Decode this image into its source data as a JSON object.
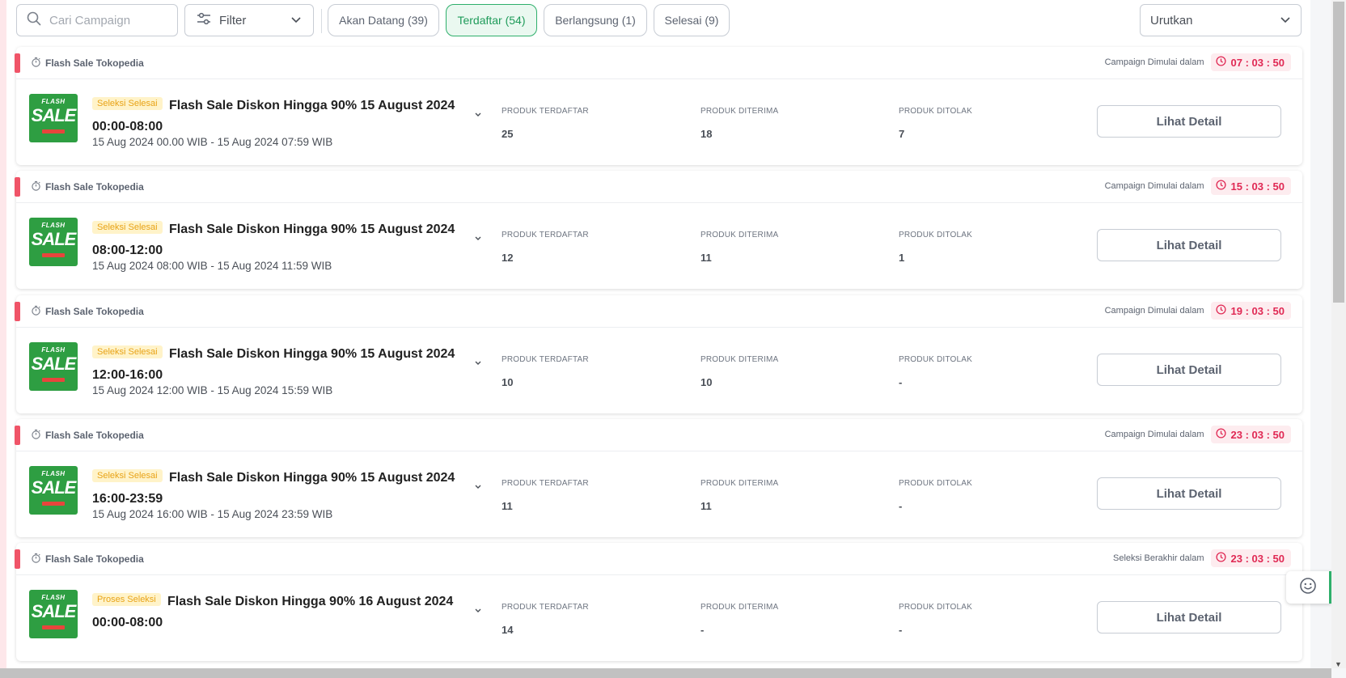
{
  "search": {
    "placeholder": "Cari Campaign"
  },
  "filter": {
    "label": "Filter"
  },
  "tabs": [
    {
      "label": "Akan Datang (39)",
      "active": false
    },
    {
      "label": "Terdaftar (54)",
      "active": true
    },
    {
      "label": "Berlangsung (1)",
      "active": false
    },
    {
      "label": "Selesai (9)",
      "active": false
    }
  ],
  "sort": {
    "label": "Urutkan"
  },
  "stat_headers": {
    "registered": "PRODUK TERDAFTAR",
    "accepted": "PRODUK DITERIMA",
    "rejected": "PRODUK DITOLAK"
  },
  "detail_label": "Lihat Detail",
  "thumb": {
    "top": "FLASH",
    "main": "SALE"
  },
  "campaigns": [
    {
      "source": "Flash Sale Tokopedia",
      "timer_label": "Campaign Dimulai dalam",
      "timer": "07 : 03 : 50",
      "badge": "Seleksi Selesai",
      "title": "Flash Sale Diskon Hingga 90% 15 August 2024 00:00-08:00",
      "daterange": "15 Aug 2024 00.00 WIB - 15 Aug 2024 07:59 WIB",
      "registered": "25",
      "accepted": "18",
      "rejected": "7"
    },
    {
      "source": "Flash Sale Tokopedia",
      "timer_label": "Campaign Dimulai dalam",
      "timer": "15 : 03 : 50",
      "badge": "Seleksi Selesai",
      "title": "Flash Sale Diskon Hingga 90% 15 August 2024 08:00-12:00",
      "daterange": "15 Aug 2024 08:00 WIB - 15 Aug 2024 11:59 WIB",
      "registered": "12",
      "accepted": "11",
      "rejected": "1"
    },
    {
      "source": "Flash Sale Tokopedia",
      "timer_label": "Campaign Dimulai dalam",
      "timer": "19 : 03 : 50",
      "badge": "Seleksi Selesai",
      "title": "Flash Sale Diskon Hingga 90% 15 August 2024 12:00-16:00",
      "daterange": "15 Aug 2024 12:00 WIB - 15 Aug 2024 15:59 WIB",
      "registered": "10",
      "accepted": "10",
      "rejected": "-"
    },
    {
      "source": "Flash Sale Tokopedia",
      "timer_label": "Campaign Dimulai dalam",
      "timer": "23 : 03 : 50",
      "badge": "Seleksi Selesai",
      "title": "Flash Sale Diskon Hingga 90% 15 August 2024 16:00-23:59",
      "daterange": "15 Aug 2024 16:00 WIB - 15 Aug 2024 23:59 WIB",
      "registered": "11",
      "accepted": "11",
      "rejected": "-"
    },
    {
      "source": "Flash Sale Tokopedia",
      "timer_label": "Seleksi Berakhir dalam",
      "timer": "23 : 03 : 50",
      "badge": "Proses Seleksi",
      "title": "Flash Sale Diskon Hingga 90% 16 August 2024 00:00-08:00",
      "daterange": "",
      "registered": "14",
      "accepted": "-",
      "rejected": "-"
    }
  ],
  "colors": {
    "accent_green": "#2eaf6b",
    "timer_red": "#e02954",
    "marker": "#f05468",
    "badge_yellow": "#e8a317"
  }
}
